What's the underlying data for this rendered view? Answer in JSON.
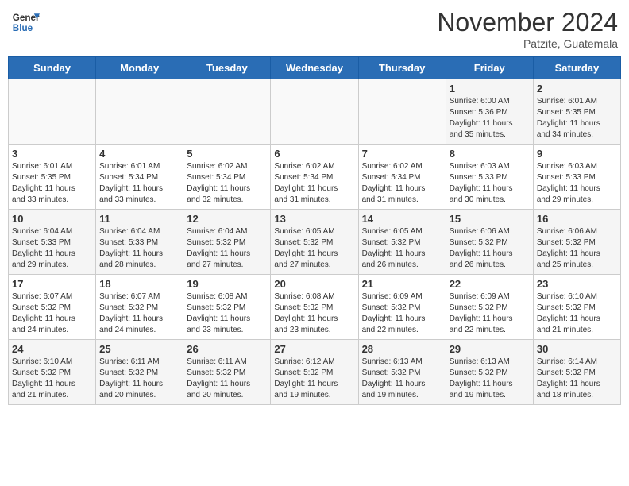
{
  "header": {
    "logo_general": "General",
    "logo_blue": "Blue",
    "month_title": "November 2024",
    "location": "Patzite, Guatemala"
  },
  "days_of_week": [
    "Sunday",
    "Monday",
    "Tuesday",
    "Wednesday",
    "Thursday",
    "Friday",
    "Saturday"
  ],
  "weeks": [
    [
      {
        "day": "",
        "info": ""
      },
      {
        "day": "",
        "info": ""
      },
      {
        "day": "",
        "info": ""
      },
      {
        "day": "",
        "info": ""
      },
      {
        "day": "",
        "info": ""
      },
      {
        "day": "1",
        "info": "Sunrise: 6:00 AM\nSunset: 5:36 PM\nDaylight: 11 hours\nand 35 minutes."
      },
      {
        "day": "2",
        "info": "Sunrise: 6:01 AM\nSunset: 5:35 PM\nDaylight: 11 hours\nand 34 minutes."
      }
    ],
    [
      {
        "day": "3",
        "info": "Sunrise: 6:01 AM\nSunset: 5:35 PM\nDaylight: 11 hours\nand 33 minutes."
      },
      {
        "day": "4",
        "info": "Sunrise: 6:01 AM\nSunset: 5:34 PM\nDaylight: 11 hours\nand 33 minutes."
      },
      {
        "day": "5",
        "info": "Sunrise: 6:02 AM\nSunset: 5:34 PM\nDaylight: 11 hours\nand 32 minutes."
      },
      {
        "day": "6",
        "info": "Sunrise: 6:02 AM\nSunset: 5:34 PM\nDaylight: 11 hours\nand 31 minutes."
      },
      {
        "day": "7",
        "info": "Sunrise: 6:02 AM\nSunset: 5:34 PM\nDaylight: 11 hours\nand 31 minutes."
      },
      {
        "day": "8",
        "info": "Sunrise: 6:03 AM\nSunset: 5:33 PM\nDaylight: 11 hours\nand 30 minutes."
      },
      {
        "day": "9",
        "info": "Sunrise: 6:03 AM\nSunset: 5:33 PM\nDaylight: 11 hours\nand 29 minutes."
      }
    ],
    [
      {
        "day": "10",
        "info": "Sunrise: 6:04 AM\nSunset: 5:33 PM\nDaylight: 11 hours\nand 29 minutes."
      },
      {
        "day": "11",
        "info": "Sunrise: 6:04 AM\nSunset: 5:33 PM\nDaylight: 11 hours\nand 28 minutes."
      },
      {
        "day": "12",
        "info": "Sunrise: 6:04 AM\nSunset: 5:32 PM\nDaylight: 11 hours\nand 27 minutes."
      },
      {
        "day": "13",
        "info": "Sunrise: 6:05 AM\nSunset: 5:32 PM\nDaylight: 11 hours\nand 27 minutes."
      },
      {
        "day": "14",
        "info": "Sunrise: 6:05 AM\nSunset: 5:32 PM\nDaylight: 11 hours\nand 26 minutes."
      },
      {
        "day": "15",
        "info": "Sunrise: 6:06 AM\nSunset: 5:32 PM\nDaylight: 11 hours\nand 26 minutes."
      },
      {
        "day": "16",
        "info": "Sunrise: 6:06 AM\nSunset: 5:32 PM\nDaylight: 11 hours\nand 25 minutes."
      }
    ],
    [
      {
        "day": "17",
        "info": "Sunrise: 6:07 AM\nSunset: 5:32 PM\nDaylight: 11 hours\nand 24 minutes."
      },
      {
        "day": "18",
        "info": "Sunrise: 6:07 AM\nSunset: 5:32 PM\nDaylight: 11 hours\nand 24 minutes."
      },
      {
        "day": "19",
        "info": "Sunrise: 6:08 AM\nSunset: 5:32 PM\nDaylight: 11 hours\nand 23 minutes."
      },
      {
        "day": "20",
        "info": "Sunrise: 6:08 AM\nSunset: 5:32 PM\nDaylight: 11 hours\nand 23 minutes."
      },
      {
        "day": "21",
        "info": "Sunrise: 6:09 AM\nSunset: 5:32 PM\nDaylight: 11 hours\nand 22 minutes."
      },
      {
        "day": "22",
        "info": "Sunrise: 6:09 AM\nSunset: 5:32 PM\nDaylight: 11 hours\nand 22 minutes."
      },
      {
        "day": "23",
        "info": "Sunrise: 6:10 AM\nSunset: 5:32 PM\nDaylight: 11 hours\nand 21 minutes."
      }
    ],
    [
      {
        "day": "24",
        "info": "Sunrise: 6:10 AM\nSunset: 5:32 PM\nDaylight: 11 hours\nand 21 minutes."
      },
      {
        "day": "25",
        "info": "Sunrise: 6:11 AM\nSunset: 5:32 PM\nDaylight: 11 hours\nand 20 minutes."
      },
      {
        "day": "26",
        "info": "Sunrise: 6:11 AM\nSunset: 5:32 PM\nDaylight: 11 hours\nand 20 minutes."
      },
      {
        "day": "27",
        "info": "Sunrise: 6:12 AM\nSunset: 5:32 PM\nDaylight: 11 hours\nand 19 minutes."
      },
      {
        "day": "28",
        "info": "Sunrise: 6:13 AM\nSunset: 5:32 PM\nDaylight: 11 hours\nand 19 minutes."
      },
      {
        "day": "29",
        "info": "Sunrise: 6:13 AM\nSunset: 5:32 PM\nDaylight: 11 hours\nand 19 minutes."
      },
      {
        "day": "30",
        "info": "Sunrise: 6:14 AM\nSunset: 5:32 PM\nDaylight: 11 hours\nand 18 minutes."
      }
    ]
  ]
}
